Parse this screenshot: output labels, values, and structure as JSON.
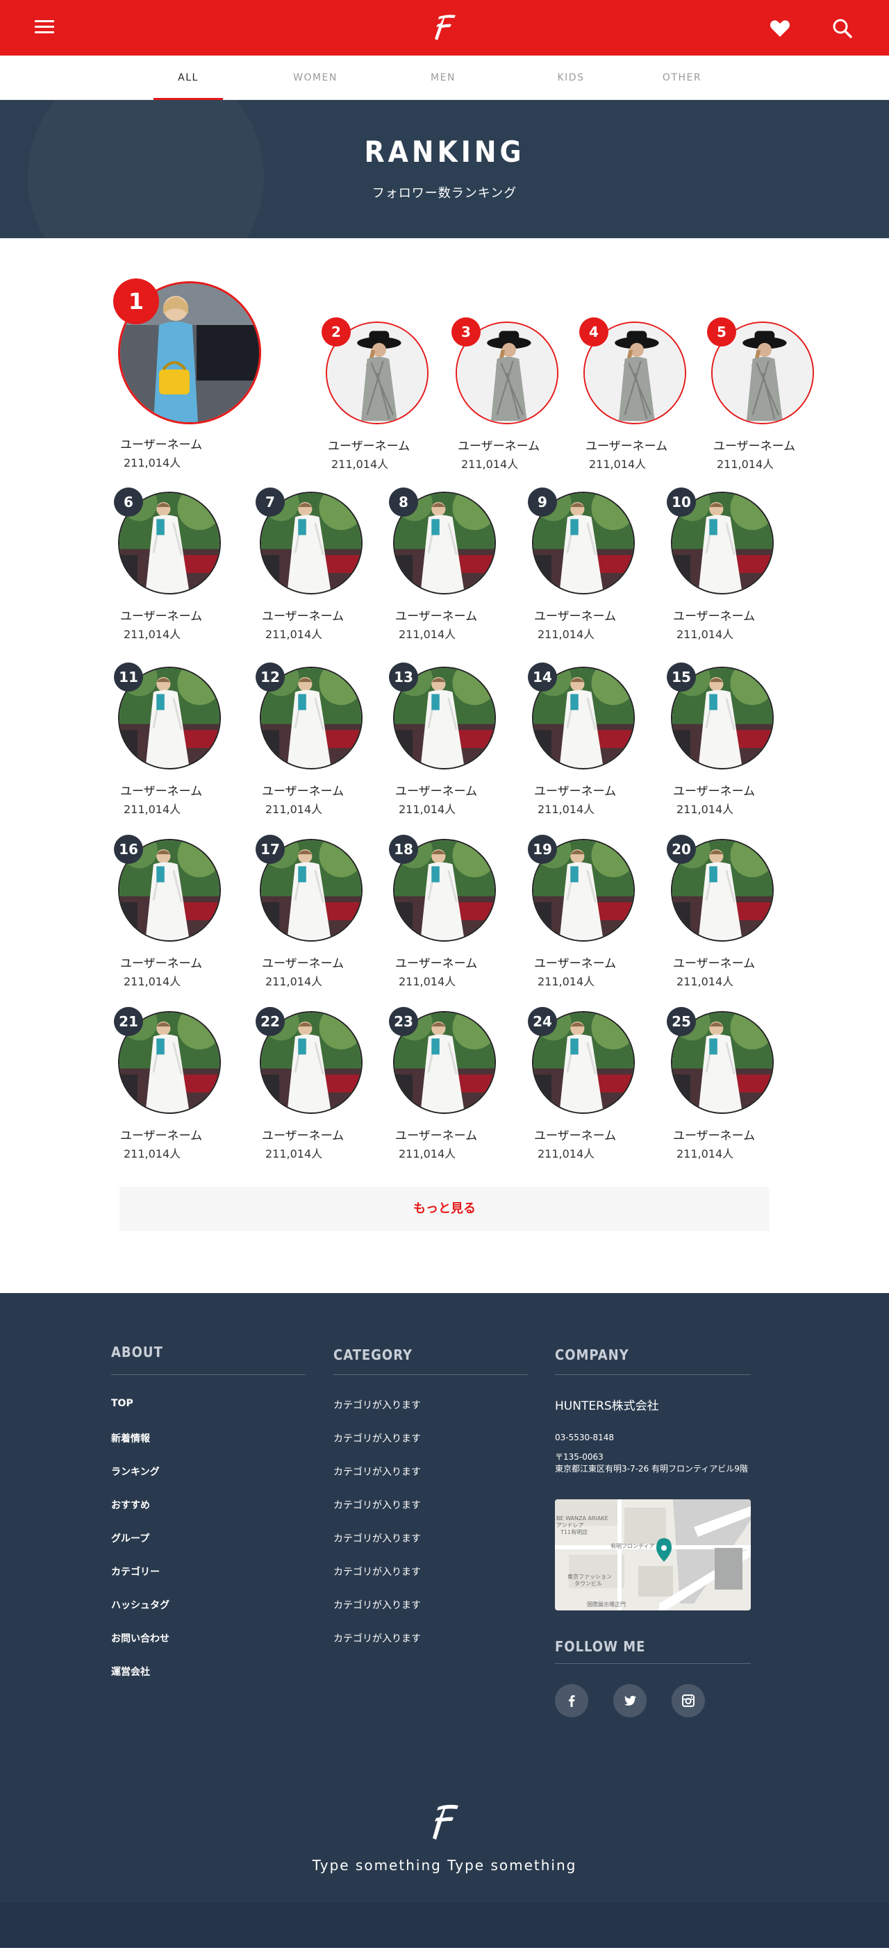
{
  "header": {
    "menu_icon": "hamburger-menu-icon",
    "logo_icon": "script-f-logo-icon",
    "favorite_icon": "heart-icon",
    "search_icon": "search-icon",
    "brand_color": "#e51a1a"
  },
  "tabs": [
    {
      "label": "ALL",
      "active": true
    },
    {
      "label": "WOMEN",
      "active": false
    },
    {
      "label": "MEN",
      "active": false
    },
    {
      "label": "KIDS",
      "active": false
    },
    {
      "label": "OTHER",
      "active": false
    }
  ],
  "hero": {
    "title": "RANKING",
    "subtitle": "フォロワー数ランキング"
  },
  "ranking": [
    {
      "rank": "1",
      "name": "ユーザーネーム",
      "followers": "211,014人"
    },
    {
      "rank": "2",
      "name": "ユーザーネーム",
      "followers": "211,014人"
    },
    {
      "rank": "3",
      "name": "ユーザーネーム",
      "followers": "211,014人"
    },
    {
      "rank": "4",
      "name": "ユーザーネーム",
      "followers": "211,014人"
    },
    {
      "rank": "5",
      "name": "ユーザーネーム",
      "followers": "211,014人"
    },
    {
      "rank": "6",
      "name": "ユーザーネーム",
      "followers": "211,014人"
    },
    {
      "rank": "7",
      "name": "ユーザーネーム",
      "followers": "211,014人"
    },
    {
      "rank": "8",
      "name": "ユーザーネーム",
      "followers": "211,014人"
    },
    {
      "rank": "9",
      "name": "ユーザーネーム",
      "followers": "211,014人"
    },
    {
      "rank": "10",
      "name": "ユーザーネーム",
      "followers": "211,014人"
    },
    {
      "rank": "11",
      "name": "ユーザーネーム",
      "followers": "211,014人"
    },
    {
      "rank": "12",
      "name": "ユーザーネーム",
      "followers": "211,014人"
    },
    {
      "rank": "13",
      "name": "ユーザーネーム",
      "followers": "211,014人"
    },
    {
      "rank": "14",
      "name": "ユーザーネーム",
      "followers": "211,014人"
    },
    {
      "rank": "15",
      "name": "ユーザーネーム",
      "followers": "211,014人"
    },
    {
      "rank": "16",
      "name": "ユーザーネーム",
      "followers": "211,014人"
    },
    {
      "rank": "17",
      "name": "ユーザーネーム",
      "followers": "211,014人"
    },
    {
      "rank": "18",
      "name": "ユーザーネーム",
      "followers": "211,014人"
    },
    {
      "rank": "19",
      "name": "ユーザーネーム",
      "followers": "211,014人"
    },
    {
      "rank": "20",
      "name": "ユーザーネーム",
      "followers": "211,014人"
    },
    {
      "rank": "21",
      "name": "ユーザーネーム",
      "followers": "211,014人"
    },
    {
      "rank": "22",
      "name": "ユーザーネーム",
      "followers": "211,014人"
    },
    {
      "rank": "23",
      "name": "ユーザーネーム",
      "followers": "211,014人"
    },
    {
      "rank": "24",
      "name": "ユーザーネーム",
      "followers": "211,014人"
    },
    {
      "rank": "25",
      "name": "ユーザーネーム",
      "followers": "211,014人"
    }
  ],
  "more_button": "もっと見る",
  "footer": {
    "about": {
      "title": "ABOUT",
      "links": [
        "TOP",
        "新着情報",
        "ランキング",
        "おすすめ",
        "グループ",
        "カテゴリー",
        "ハッシュタグ",
        "お問い合わせ",
        "運営会社"
      ]
    },
    "category": {
      "title": "CATEGORY",
      "links": [
        "カテゴリが入ります",
        "カテゴリが入ります",
        "カテゴリが入ります",
        "カテゴリが入ります",
        "カテゴリが入ります",
        "カテゴリが入ります",
        "カテゴリが入ります",
        "カテゴリが入ります"
      ]
    },
    "company": {
      "title": "COMPANY",
      "name": "HUNTERS株式会社",
      "phone": "03-5530-8148",
      "postal": "〒135-0063",
      "address": "東京都江東区有明3-7-26 有明フロンティアビル9階",
      "map_labels": [
        "BE WANZA ARIAKE",
        "アンドレア",
        "T11有明店",
        "有明フロンティア",
        "東京ファッション",
        "タウンビル",
        "国際展示場正門"
      ]
    },
    "follow": {
      "title": "FOLLOW ME",
      "icons": [
        "facebook-icon",
        "twitter-icon",
        "instagram-icon"
      ]
    },
    "tagline": "Type something Type something"
  }
}
